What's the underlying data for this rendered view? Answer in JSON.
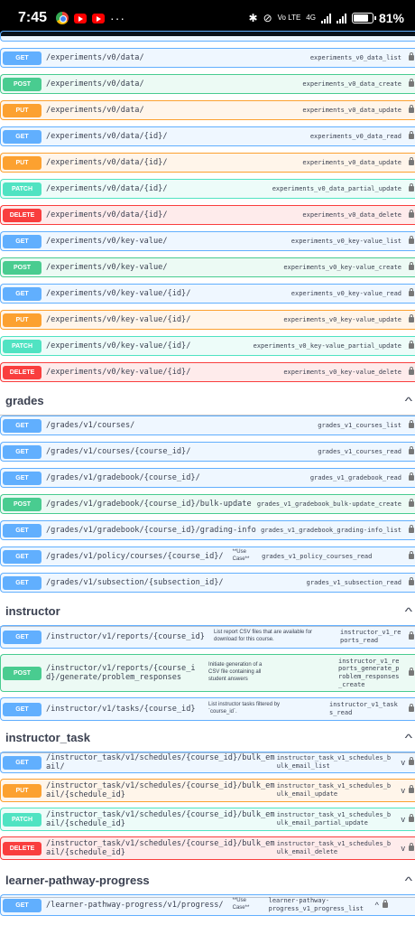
{
  "status_bar": {
    "time": "7:45",
    "battery_pct": "81%",
    "network_top": "Vo LTE",
    "network_gen": "4G",
    "more": "···"
  },
  "tags": [
    {
      "title": "grades",
      "collapse_icon": "chevron-up-icon"
    },
    {
      "title": "instructor",
      "collapse_icon": "chevron-up-icon"
    },
    {
      "title": "instructor_task",
      "collapse_icon": "chevron-up-icon"
    },
    {
      "title": "learner-pathway-progress",
      "collapse_icon": "chevron-up-icon"
    }
  ],
  "operations": [
    {
      "method": "GET",
      "path": "/experiments/v0/data/",
      "op_id": "experiments_v0_data_list"
    },
    {
      "method": "POST",
      "path": "/experiments/v0/data/",
      "op_id": "experiments_v0_data_create"
    },
    {
      "method": "PUT",
      "path": "/experiments/v0/data/",
      "op_id": "experiments_v0_data_update"
    },
    {
      "method": "GET",
      "path": "/experiments/v0/data/{id}/",
      "op_id": "experiments_v0_data_read"
    },
    {
      "method": "PUT",
      "path": "/experiments/v0/data/{id}/",
      "op_id": "experiments_v0_data_update"
    },
    {
      "method": "PATCH",
      "path": "/experiments/v0/data/{id}/",
      "op_id": "experiments_v0_data_partial_update"
    },
    {
      "method": "DELETE",
      "path": "/experiments/v0/data/{id}/",
      "op_id": "experiments_v0_data_delete"
    },
    {
      "method": "GET",
      "path": "/experiments/v0/key-value/",
      "op_id": "experiments_v0_key-value_list"
    },
    {
      "method": "POST",
      "path": "/experiments/v0/key-value/",
      "op_id": "experiments_v0_key-value_create"
    },
    {
      "method": "GET",
      "path": "/experiments/v0/key-value/{id}/",
      "op_id": "experiments_v0_key-value_read"
    },
    {
      "method": "PUT",
      "path": "/experiments/v0/key-value/{id}/",
      "op_id": "experiments_v0_key-value_update"
    },
    {
      "method": "PATCH",
      "path": "/experiments/v0/key-value/{id}/",
      "op_id": "experiments_v0_key-value_partial_update"
    },
    {
      "method": "DELETE",
      "path": "/experiments/v0/key-value/{id}/",
      "op_id": "experiments_v0_key-value_delete"
    },
    {
      "method": "GET",
      "path": "/grades/v1/courses/",
      "op_id": "grades_v1_courses_list"
    },
    {
      "method": "GET",
      "path": "/grades/v1/courses/{course_id}/",
      "op_id": "grades_v1_courses_read"
    },
    {
      "method": "GET",
      "path": "/grades/v1/gradebook/{course_id}/",
      "op_id": "grades_v1_gradebook_read"
    },
    {
      "method": "POST",
      "path": "/grades/v1/gradebook/{course_id}/bulk-update",
      "op_id": "grades_v1_gradebook_bulk-update_create"
    },
    {
      "method": "GET",
      "path": "/grades/v1/gradebook/{course_id}/grading-info",
      "op_id": "grades_v1_gradebook_grading-info_list"
    },
    {
      "method": "GET",
      "path": "/grades/v1/policy/courses/{course_id}/",
      "description": "**Use Case**",
      "op_id": "grades_v1_policy_courses_read"
    },
    {
      "method": "GET",
      "path": "/grades/v1/subsection/{subsection_id}/",
      "op_id": "grades_v1_subsection_read"
    },
    {
      "method": "GET",
      "path": "/instructor/v1/reports/{course_id}",
      "description": "List report CSV files that are available for download for this course.",
      "op_id": "instructor_v1_reports_read"
    },
    {
      "method": "POST",
      "path": "/instructor/v1/reports/{course_id}/generate/problem_responses",
      "description": "Initiate generation of a CSV file containing all student answers",
      "op_id": "instructor_v1_reports_generate_problem_responses_create"
    },
    {
      "method": "GET",
      "path": "/instructor/v1/tasks/{course_id}",
      "description": "List instructor tasks filtered by `course_id`.",
      "op_id": "instructor_v1_tasks_read"
    },
    {
      "method": "GET",
      "path": "/instructor_task/v1/schedules/{course_id}/bulk_email/",
      "op_id": "instructor_task_v1_schedules_bulk_email_list"
    },
    {
      "method": "PUT",
      "path": "/instructor_task/v1/schedules/{course_id}/bulk_email/{schedule_id}",
      "op_id": "instructor_task_v1_schedules_bulk_email_update"
    },
    {
      "method": "PATCH",
      "path": "/instructor_task/v1/schedules/{course_id}/bulk_email/{schedule_id}",
      "op_id": "instructor_task_v1_schedules_bulk_email_partial_update"
    },
    {
      "method": "DELETE",
      "path": "/instructor_task/v1/schedules/{course_id}/bulk_email/{schedule_id}",
      "op_id": "instructor_task_v1_schedules_bulk_email_delete"
    },
    {
      "method": "GET",
      "path": "/learner-pathway-progress/v1/progress/",
      "description": "**Use Case**",
      "op_id": "learner-pathway-progress_v1_progress_list"
    }
  ],
  "colors": {
    "get": "#61affe",
    "post": "#49cc90",
    "put": "#fca130",
    "patch": "#50e3c2",
    "delete": "#f93e3e"
  }
}
